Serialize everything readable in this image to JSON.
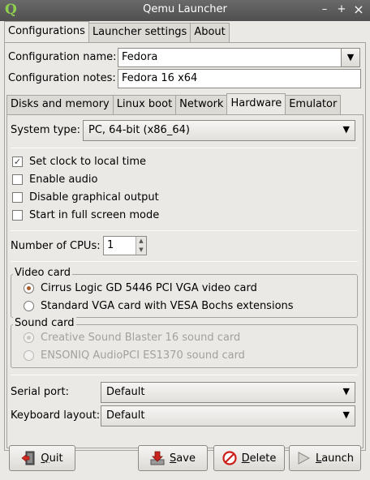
{
  "window": {
    "title": "Qemu Launcher",
    "app_icon": "Q",
    "minimize": "–",
    "maximize": "+",
    "close": "×"
  },
  "main_tabs": [
    "Configurations",
    "Launcher settings",
    "About"
  ],
  "config_name": {
    "label": "Configuration name:",
    "value": "Fedora"
  },
  "config_notes": {
    "label": "Configuration notes:",
    "value": "Fedora 16 x64"
  },
  "sub_tabs": [
    "Disks and memory",
    "Linux boot",
    "Network",
    "Hardware",
    "Emulator"
  ],
  "hardware": {
    "system_type": {
      "label": "System type:",
      "value": "PC, 64-bit (x86_64)"
    },
    "options": [
      {
        "label": "Set clock to local time",
        "checked": true
      },
      {
        "label": "Enable audio",
        "checked": false
      },
      {
        "label": "Disable graphical output",
        "checked": false
      },
      {
        "label": "Start in full screen mode",
        "checked": false
      }
    ],
    "cpus": {
      "label": "Number of CPUs:",
      "value": "1"
    },
    "video_card": {
      "title": "Video card",
      "options": [
        {
          "label": "Cirrus Logic GD 5446 PCI VGA video card",
          "selected": true
        },
        {
          "label": "Standard VGA card with VESA Bochs extensions",
          "selected": false
        }
      ]
    },
    "sound_card": {
      "title": "Sound card",
      "enabled": false,
      "options": [
        {
          "label": "Creative Sound Blaster 16 sound card",
          "selected": true
        },
        {
          "label": "ENSONIQ AudioPCI ES1370 sound card",
          "selected": false
        }
      ]
    },
    "serial_port": {
      "label": "Serial port:",
      "value": "Default"
    },
    "keyboard_layout": {
      "label": "Keyboard layout:",
      "value": "Default"
    }
  },
  "buttons": {
    "quit": {
      "pre": "",
      "mnemonic": "Q",
      "post": "uit"
    },
    "save": {
      "pre": "",
      "mnemonic": "S",
      "post": "ave"
    },
    "delete": {
      "pre": "",
      "mnemonic": "D",
      "post": "elete"
    },
    "launch": {
      "pre": "",
      "mnemonic": "L",
      "post": "aunch"
    }
  },
  "colors": {
    "accent_radio": "#a85c2a",
    "app_icon": "#8fd14f",
    "delete_icon": "#cc1f1a",
    "save_icon": "#c8231c"
  }
}
